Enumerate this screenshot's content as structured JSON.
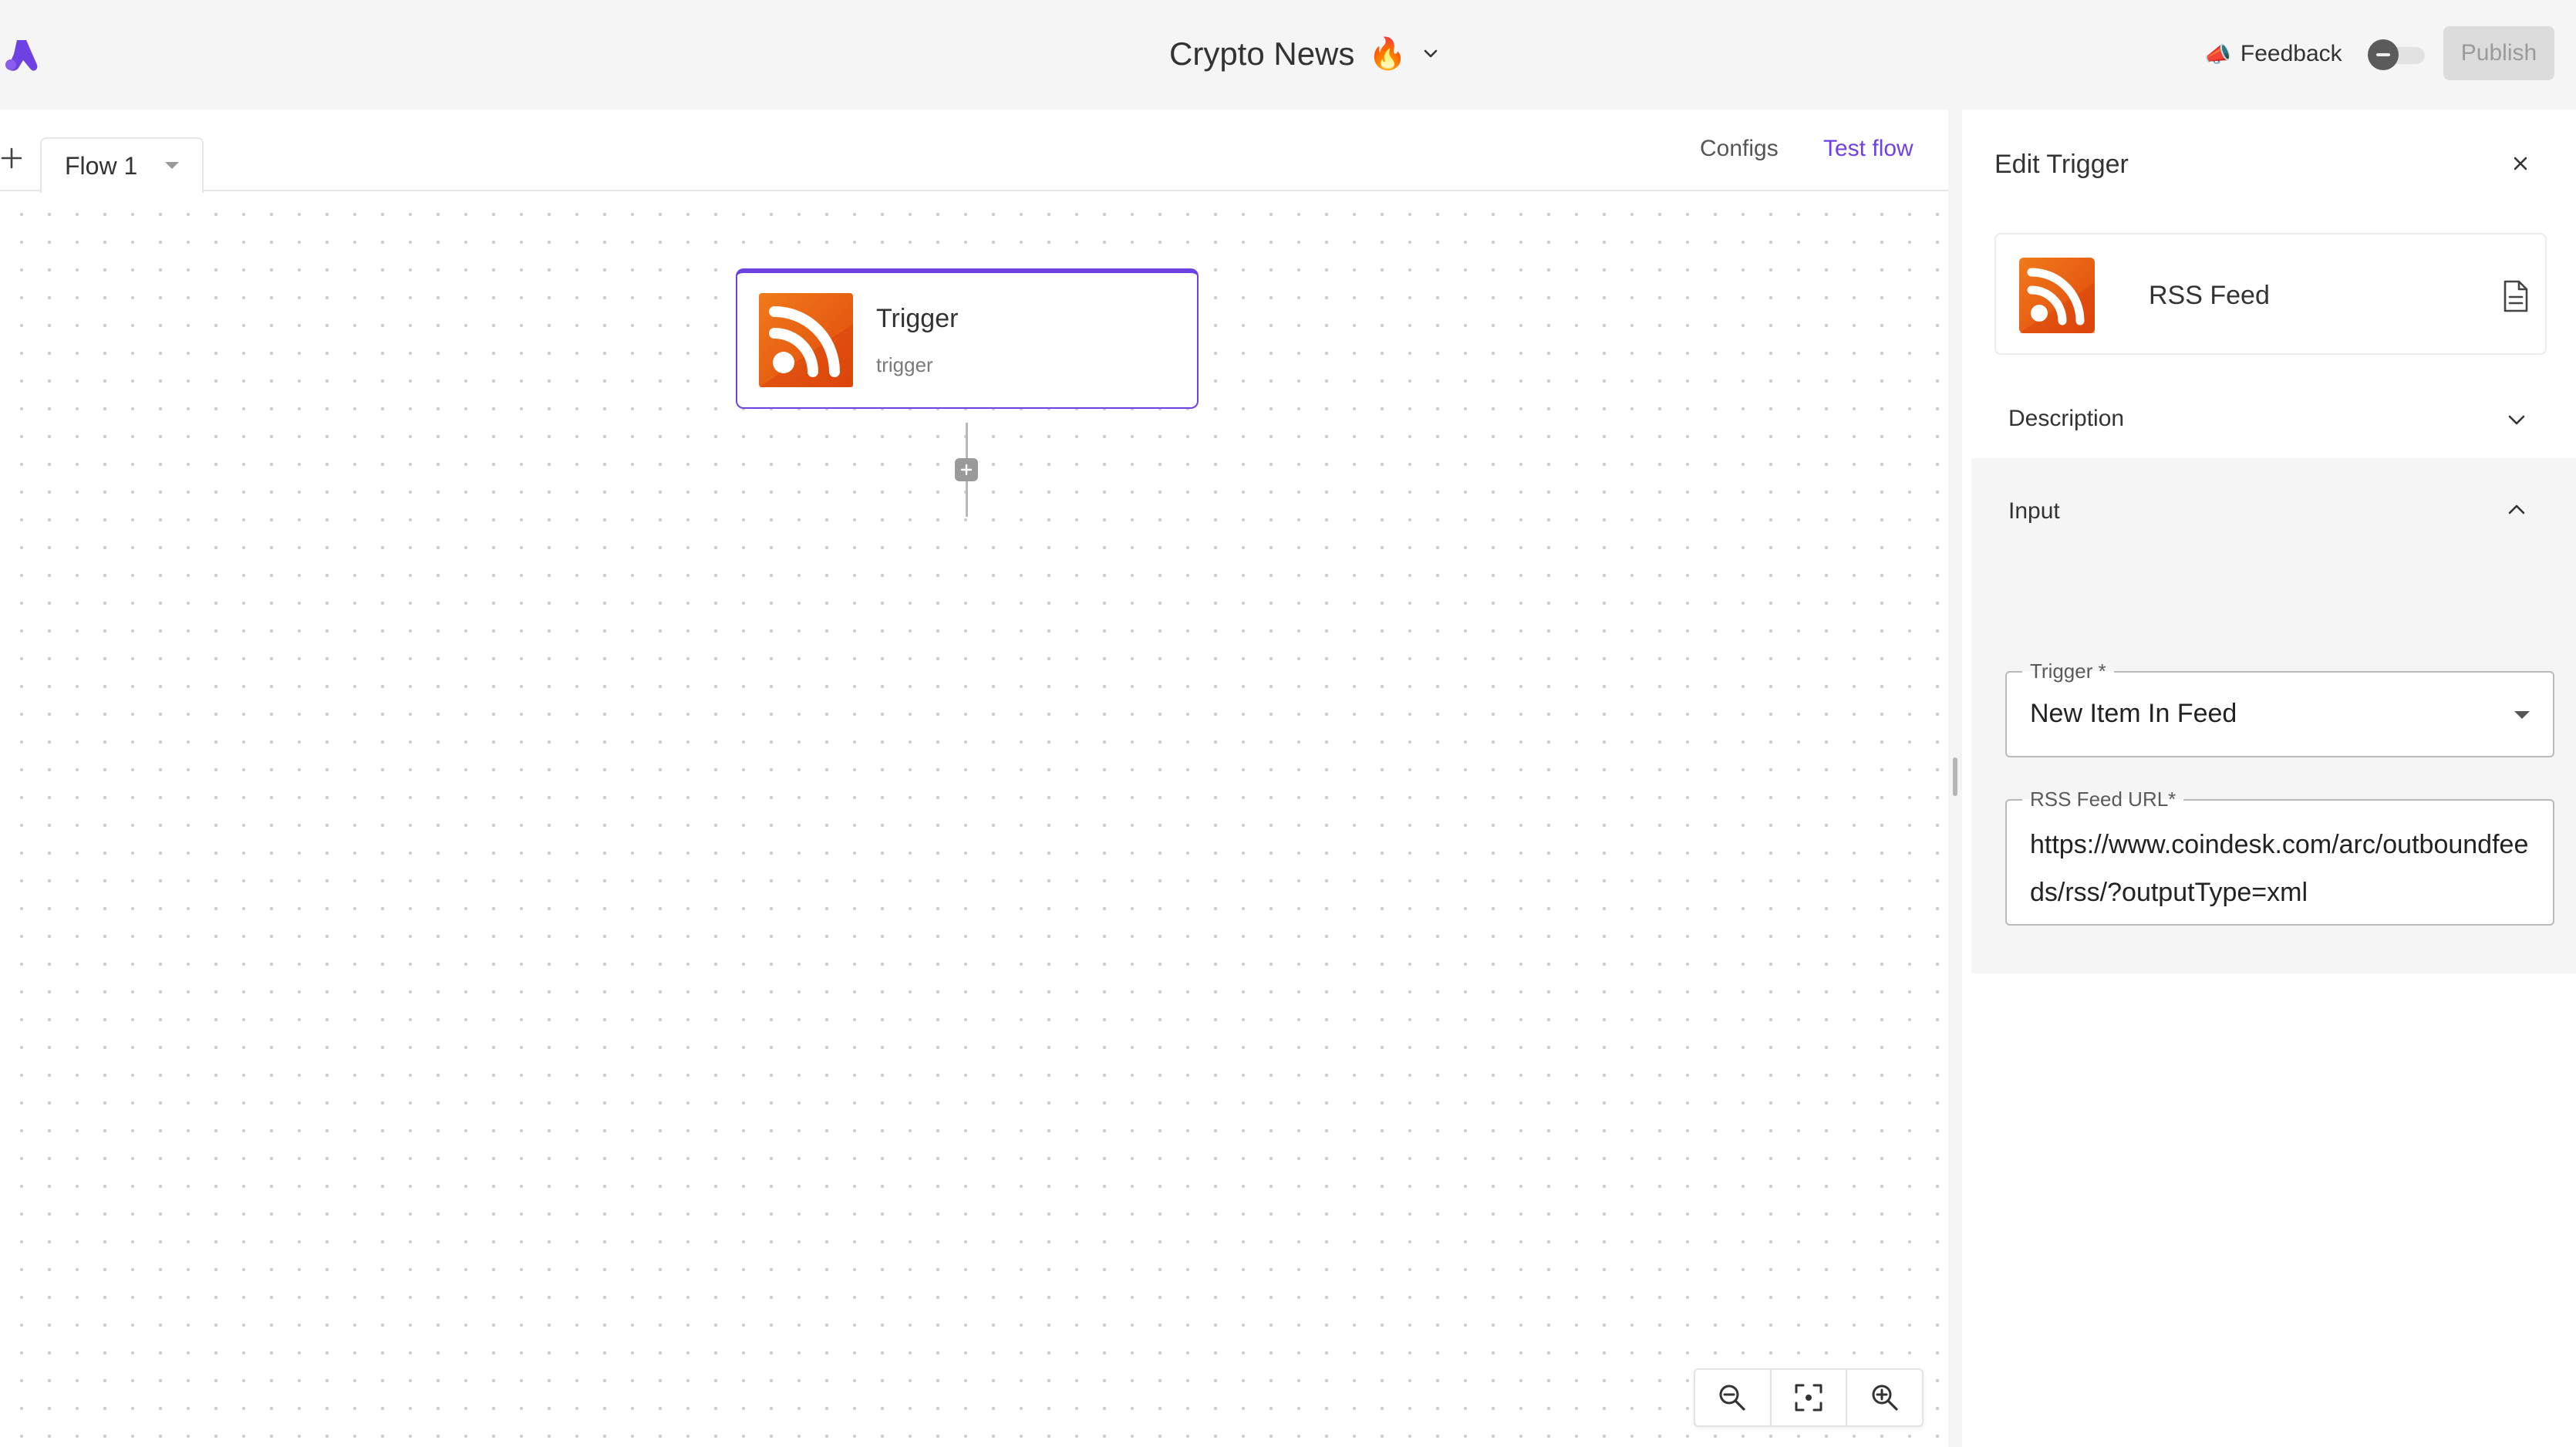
{
  "topbar": {
    "flow_name": "Crypto News",
    "flow_emoji": "🔥",
    "feedback_label": "Feedback",
    "feedback_emoji": "📣",
    "publish_label": "Publish",
    "brand_color": "#6e41e2"
  },
  "tabs": {
    "items": [
      {
        "label": "Flow 1"
      }
    ],
    "configs_label": "Configs",
    "test_flow_label": "Test flow"
  },
  "canvas": {
    "trigger_step": {
      "title": "Trigger",
      "subtitle": "trigger",
      "icon": "rss-icon",
      "icon_color": "#ee5a10"
    },
    "zoom_controls": [
      "zoom-out-icon",
      "fit-view-icon",
      "zoom-in-icon"
    ]
  },
  "panel": {
    "title": "Edit Trigger",
    "piece": {
      "name": "RSS Feed",
      "icon": "rss-icon"
    },
    "description_label": "Description",
    "input_label": "Input",
    "fields": {
      "trigger": {
        "label": "Trigger *",
        "value": "New Item In Feed"
      },
      "rss_url": {
        "label": "RSS Feed URL*",
        "value": "https://www.coindesk.com/arc/outboundfeeds/rss/?outputType=xml"
      }
    }
  }
}
